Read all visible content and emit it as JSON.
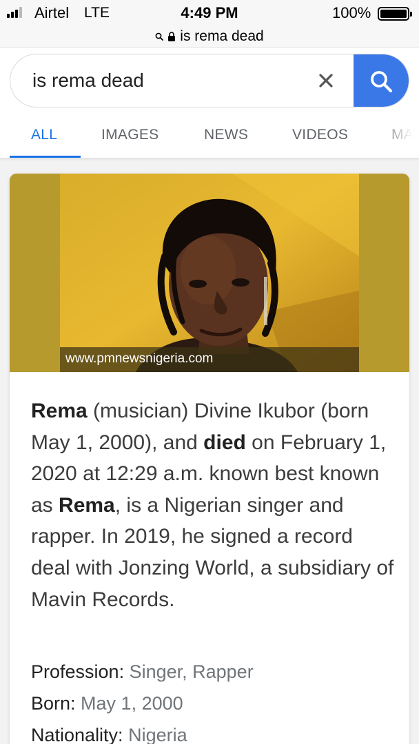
{
  "status_bar": {
    "carrier": "Airtel",
    "network": "LTE",
    "time": "4:49 PM",
    "battery": "100%",
    "battery_level": 1.0
  },
  "browser": {
    "url_text": "is rema dead"
  },
  "search": {
    "query": "is rema dead",
    "clear_icon": "close-icon",
    "submit_icon": "search-icon",
    "accent": "#3b78e7"
  },
  "tabs": [
    {
      "label": "ALL",
      "active": true
    },
    {
      "label": "IMAGES",
      "active": false
    },
    {
      "label": "NEWS",
      "active": false
    },
    {
      "label": "VIDEOS",
      "active": false
    },
    {
      "label": "MA",
      "active": false
    }
  ],
  "card": {
    "image_source": "www.pmnewsnigeria.com",
    "description": {
      "seg1": "Rema",
      "seg2": " (musician) Divine Ikubor (born May 1, 2000), and ",
      "seg3": "died",
      "seg4": " on February 1, 2020 at 12:29 a.m. known best known as ",
      "seg5": "Rema",
      "seg6": ", is a Nigerian singer and rapper. In 2019, he signed a record deal with Jonzing World, a subsidiary of Mavin Records."
    },
    "facts": [
      {
        "label": "Profession: ",
        "value": "Singer, Rapper"
      },
      {
        "label": "Born: ",
        "value": "May 1, 2000"
      },
      {
        "label": "Nationality: ",
        "value": "Nigeria"
      }
    ]
  },
  "colors": {
    "active_tab": "#1a73e8",
    "hero_background": "#b79a2e",
    "fact_value": "#70757a"
  }
}
